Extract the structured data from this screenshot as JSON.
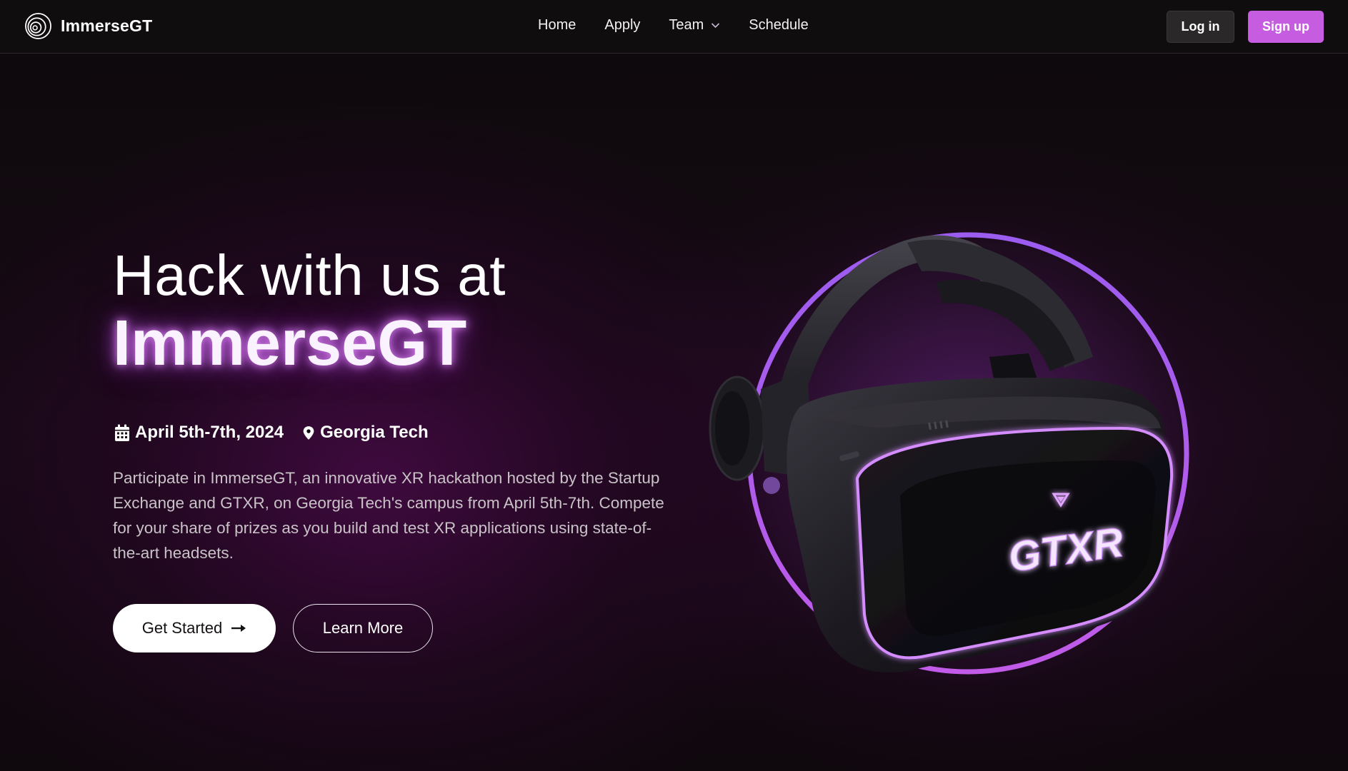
{
  "nav": {
    "brand": "ImmerseGT",
    "links": [
      {
        "label": "Home"
      },
      {
        "label": "Apply"
      },
      {
        "label": "Team",
        "has_dropdown": true
      },
      {
        "label": "Schedule"
      }
    ],
    "login_label": "Log in",
    "signup_label": "Sign up"
  },
  "hero": {
    "line1": "Hack with us at",
    "line2": "ImmerseGT",
    "date": "April 5th-7th, 2024",
    "location": "Georgia Tech",
    "description": "Participate in ImmerseGT, an innovative XR hackathon hosted by the Startup Exchange and GTXR, on Georgia Tech's campus from April 5th-7th. Compete for your share of prizes as you build and test XR applications using state-of-the-art headsets.",
    "primary_cta": "Get Started",
    "secondary_cta": "Learn More"
  },
  "visual": {
    "headset_logo_text": "GTXR"
  },
  "colors": {
    "accent": "#c65ce0",
    "ring_start": "#9b5cf0",
    "ring_end": "#c15be8",
    "nav_bg": "#0f0d0e"
  },
  "icons": [
    "brand-logo-icon",
    "chevron-down-icon",
    "calendar-icon",
    "map-pin-icon",
    "arrow-right-icon"
  ]
}
